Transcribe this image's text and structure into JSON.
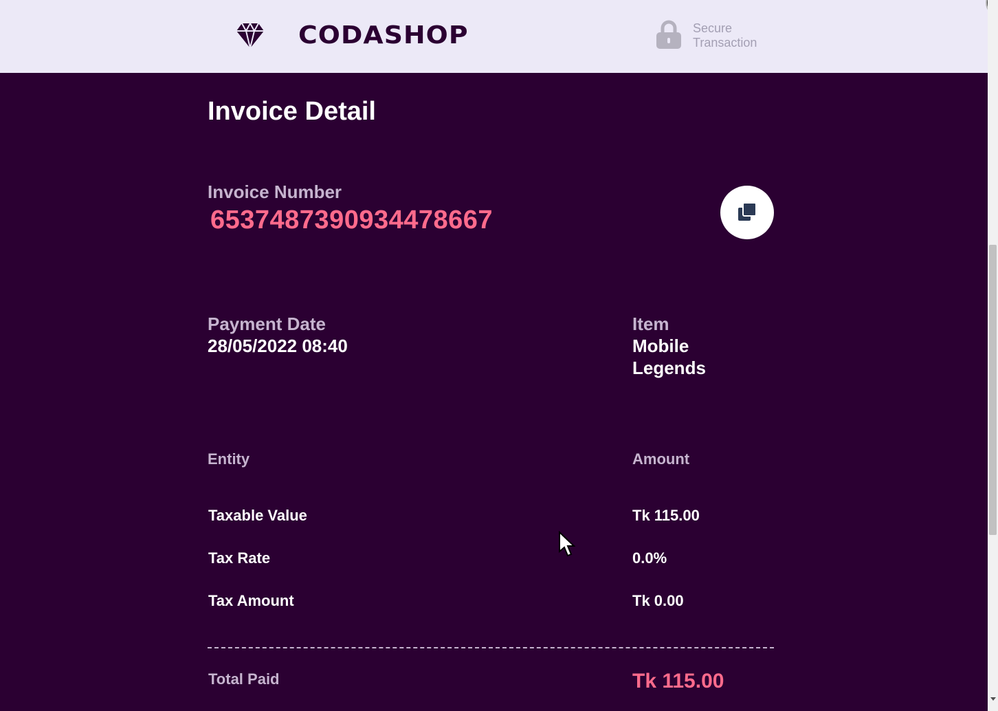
{
  "header": {
    "logo_text": "CODASHOP",
    "secure_line1": "Secure",
    "secure_line2": "Transaction"
  },
  "invoice": {
    "title": "Invoice Detail",
    "number_label": "Invoice Number",
    "number_value": "6537487390934478667",
    "payment_date_label": "Payment Date",
    "payment_date_value": "28/05/2022 08:40",
    "item_label": "Item",
    "item_value_line1": "Mobile",
    "item_value_line2": "Legends"
  },
  "breakdown": {
    "entity_header": "Entity",
    "amount_header": "Amount",
    "rows": [
      {
        "entity": "Taxable Value",
        "amount": "Tk 115.00"
      },
      {
        "entity": "Tax Rate",
        "amount": "0.0%"
      },
      {
        "entity": "Tax Amount",
        "amount": "Tk 0.00"
      }
    ],
    "total_label": "Total Paid",
    "total_value": "Tk 115.00"
  },
  "colors": {
    "background": "#2b0032",
    "header_bg": "#ece9f7",
    "accent_pink": "#ff6b8c",
    "label_muted": "#c6b4cf"
  },
  "icons": {
    "logo": "diamond-gem-icon",
    "secure": "lock-icon",
    "copy": "copy-icon"
  }
}
